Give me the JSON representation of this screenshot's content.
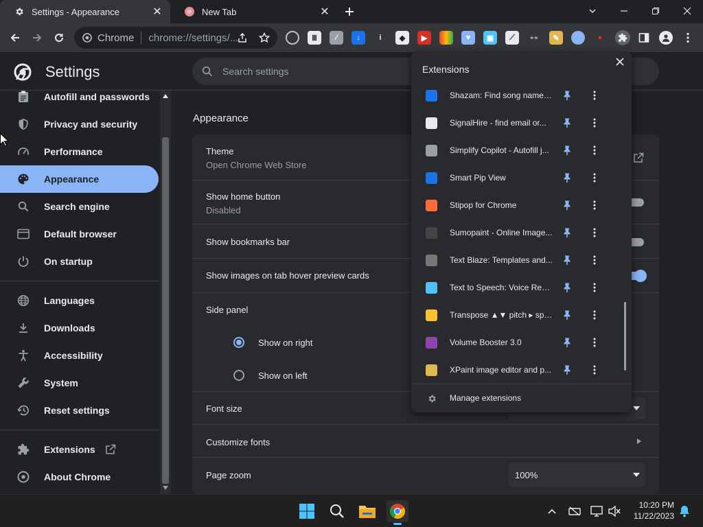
{
  "tabs": [
    {
      "title": "Settings - Appearance",
      "icon": "gear-icon",
      "active": true
    },
    {
      "title": "New Tab",
      "icon": "chrome-tab-icon",
      "active": false
    }
  ],
  "omnibox": {
    "site": "Chrome",
    "url": "chrome://settings/..."
  },
  "header": {
    "title": "Settings",
    "search_placeholder": "Search settings"
  },
  "sidebar": {
    "items": [
      {
        "label": "Autofill and passwords",
        "icon": "clipboard-icon"
      },
      {
        "label": "Privacy and security",
        "icon": "shield-icon"
      },
      {
        "label": "Performance",
        "icon": "speedometer-icon"
      },
      {
        "label": "Appearance",
        "icon": "palette-icon",
        "selected": true
      },
      {
        "label": "Search engine",
        "icon": "search-icon"
      },
      {
        "label": "Default browser",
        "icon": "browser-icon"
      },
      {
        "label": "On startup",
        "icon": "power-icon"
      },
      {
        "label": "Languages",
        "icon": "globe-icon"
      },
      {
        "label": "Downloads",
        "icon": "download-icon"
      },
      {
        "label": "Accessibility",
        "icon": "accessibility-icon"
      },
      {
        "label": "System",
        "icon": "wrench-icon"
      },
      {
        "label": "Reset settings",
        "icon": "history-icon"
      },
      {
        "label": "Extensions",
        "icon": "puzzle-icon"
      },
      {
        "label": "About Chrome",
        "icon": "chrome-icon"
      }
    ]
  },
  "main": {
    "section_title": "Appearance",
    "theme": {
      "label": "Theme",
      "sub": "Open Chrome Web Store"
    },
    "home_button": {
      "label": "Show home button",
      "sub": "Disabled"
    },
    "bookmarks_bar": {
      "label": "Show bookmarks bar"
    },
    "hover_cards": {
      "label": "Show images on tab hover preview cards"
    },
    "side_panel": {
      "label": "Side panel",
      "option_right": "Show on right",
      "option_left": "Show on left",
      "selected": "right"
    },
    "font_size": {
      "label": "Font size"
    },
    "customize_fonts": {
      "label": "Customize fonts"
    },
    "page_zoom": {
      "label": "Page zoom",
      "value": "100%"
    }
  },
  "extensions_popup": {
    "title": "Extensions",
    "items": [
      {
        "name": "Shazam: Find song names...",
        "icon": "shazam-icon",
        "color": "#1a73e8"
      },
      {
        "name": "SignalHire - find email or...",
        "icon": "signalhire-icon",
        "color": "#e8eaed"
      },
      {
        "name": "Simplify Copilot - Autofill j...",
        "icon": "simplify-icon",
        "color": "#9aa0a6"
      },
      {
        "name": "Smart Pip View",
        "icon": "smart-pip-icon",
        "color": "#1a73e8"
      },
      {
        "name": "Stipop for Chrome",
        "icon": "stipop-icon",
        "color": "#ff6b35"
      },
      {
        "name": "Sumopaint - Online Image...",
        "icon": "sumopaint-icon",
        "color": "#444"
      },
      {
        "name": "Text Blaze: Templates and...",
        "icon": "textblaze-icon",
        "color": "#777"
      },
      {
        "name": "Text to Speech: Voice Read...",
        "icon": "megaphone-icon",
        "color": "#4fc3f7"
      },
      {
        "name": "Transpose ▲▼ pitch ▸ spe...",
        "icon": "transpose-icon",
        "color": "#fbc02d"
      },
      {
        "name": "Volume Booster 3.0",
        "icon": "volume-booster-icon",
        "color": "#8e44ad"
      },
      {
        "name": "XPaint image editor and p...",
        "icon": "xpaint-icon",
        "color": "#e0b84f"
      }
    ],
    "manage_label": "Manage extensions"
  },
  "taskbar": {
    "time": "10:20 PM",
    "date": "11/22/2023"
  }
}
